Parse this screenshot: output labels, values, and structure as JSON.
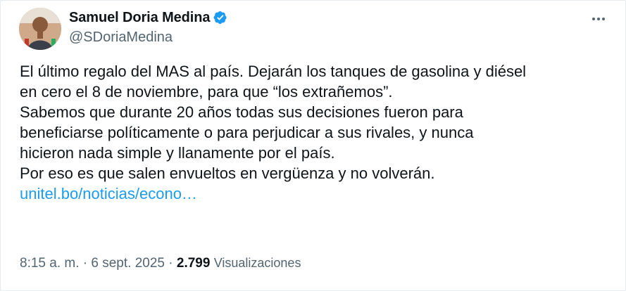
{
  "author": {
    "display_name": "Samuel Doria Medina",
    "handle": "@SDoriaMedina",
    "verified": true,
    "avatar_icon": "profile-photo"
  },
  "menu": {
    "icon": "more-horizontal-icon"
  },
  "tweet": {
    "lines": [
      "El último regalo del MAS al país. Dejarán los tanques de gasolina y diésel",
      "en cero el 8 de noviembre, para que “los extrañemos”.",
      "Sabemos que durante 20 años todas sus decisiones fueron para",
      "beneficiarse políticamente o para perjudicar a sus rivales, y nunca",
      "hicieron nada simple y llanamente por el país.",
      "Por eso es que salen envueltos en vergüenza y no volverán."
    ],
    "link_text": "unitel.bo/noticias/econo…"
  },
  "meta": {
    "time": "8:15 a. m.",
    "separator": "·",
    "date": "6 sept. 2025",
    "views_count": "2.799",
    "views_label": "Visualizaciones"
  },
  "colors": {
    "link": "#1d9bf0",
    "verified_badge": "#1d9bf0",
    "secondary_text": "#536471",
    "primary_text": "#0f1419"
  }
}
